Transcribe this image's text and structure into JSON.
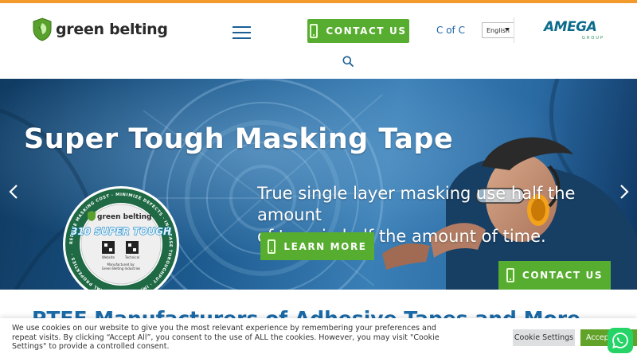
{
  "brand": {
    "name": "green belting",
    "accent": "#57ad2f",
    "topbar": "#f39a2c"
  },
  "header": {
    "contact_label": "CONTACT US",
    "cofc_label": "C of C",
    "language": "English",
    "partner_logo": {
      "word": "AMEGA",
      "sub": "GROUP"
    }
  },
  "hero": {
    "title": "Super Tough Masking Tape",
    "text_lines": [
      "True single layer masking use half the",
      "amount",
      "of tape in half the amount of time."
    ],
    "learn_more_label": "LEARN MORE",
    "contact_label": "CONTACT US",
    "badge": {
      "ring_text": "REDUCE MASKING COST · MINIMIZE DEFECTS · INCREASE THROUGHPUT · IMPROVED THERMAL PROPERTIES ·",
      "brand": "green belting",
      "product": "310 SUPER TOUGH",
      "qr_labels": [
        "Website",
        "Technical"
      ],
      "footer": [
        "Manufactured by:",
        "Green Belting Industries"
      ]
    }
  },
  "section": {
    "title": "PTFE Manufacturers of Adhesive Tapes and More"
  },
  "cookie": {
    "text": "We use cookies on our website to give you the most relevant experience by remembering your preferences and repeat visits. By clicking “Accept All”, you consent to the use of ALL the cookies. However, you may visit \"Cookie Settings\" to provide a controlled consent.",
    "settings_label": "Cookie Settings",
    "accept_label": "Accept All"
  },
  "icons": [
    "shield-logo-icon",
    "hamburger-icon",
    "phone-icon",
    "search-icon",
    "chevron-left-icon",
    "chevron-right-icon",
    "whatsapp-icon"
  ]
}
